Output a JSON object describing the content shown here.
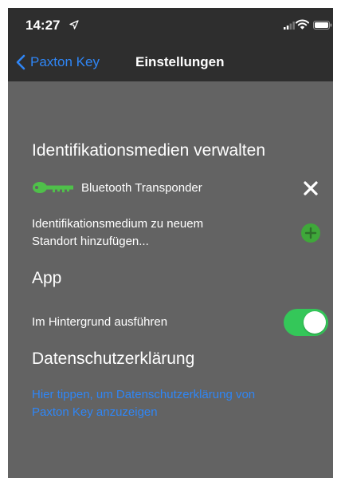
{
  "status_bar": {
    "time": "14:27",
    "icons": [
      "location-arrow-icon",
      "signal-bars-icon",
      "wifi-icon",
      "battery-icon"
    ]
  },
  "nav": {
    "back_label": "Paxton Key",
    "title": "Einstellungen"
  },
  "sections": {
    "media": {
      "header": "Identifikationsmedien verwalten",
      "item_label": "Bluetooth Transponder",
      "add_line1": "Identifikationsmedium zu neuem",
      "add_line2": "Standort hinzufügen..."
    },
    "app": {
      "header": "App",
      "background_label": "Im Hintergrund ausführen",
      "background_enabled": true
    },
    "privacy": {
      "header": "Datenschutzerklärung",
      "link_line1": "Hier tippen, um Datenschutzerklärung von",
      "link_line2": "Paxton Key anzuzeigen"
    }
  },
  "colors": {
    "background": "#636363",
    "bar": "#2e2e2e",
    "accent_blue": "#2f86f6",
    "key_green": "#4fc04a",
    "toggle_green": "#34c759"
  }
}
